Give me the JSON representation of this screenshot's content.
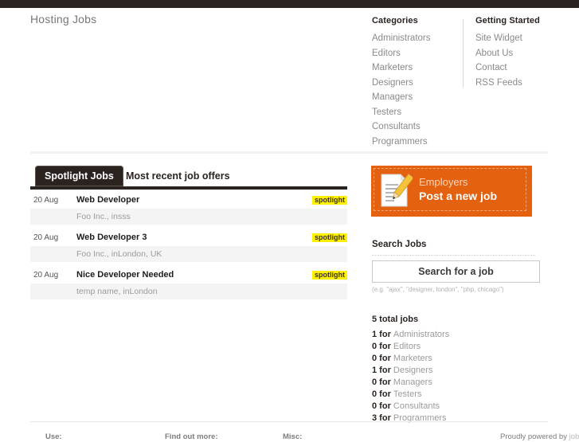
{
  "site": {
    "title": "Hosting Jobs"
  },
  "nav": {
    "categories": {
      "heading": "Categories",
      "items": [
        {
          "label": "Administrators"
        },
        {
          "label": "Editors"
        },
        {
          "label": "Marketers"
        },
        {
          "label": "Designers"
        },
        {
          "label": "Managers"
        },
        {
          "label": "Testers"
        },
        {
          "label": "Consultants"
        },
        {
          "label": "Programmers"
        }
      ]
    },
    "getting_started": {
      "heading": "Getting Started",
      "items": [
        {
          "label": "Site Widget"
        },
        {
          "label": "About Us"
        },
        {
          "label": "Contact"
        },
        {
          "label": "RSS Feeds"
        }
      ]
    }
  },
  "jobs_panel": {
    "tabs": [
      {
        "label": "Spotlight Jobs",
        "active": true
      },
      {
        "label": "Most recent job offers",
        "active": false
      }
    ],
    "listings": [
      {
        "date": "20 Aug",
        "title": "Web Developer",
        "company": "Foo Inc., insss",
        "badge": "spotlight"
      },
      {
        "date": "20 Aug",
        "title": "Web Developer 3",
        "company": "Foo Inc., inLondon, UK",
        "badge": "spotlight"
      },
      {
        "date": "20 Aug",
        "title": "Nice Developer Needed",
        "company": "temp name, inLondon",
        "badge": "spotlight"
      }
    ]
  },
  "sidebar": {
    "employers_banner": {
      "label": "Employers",
      "action": "Post a new job",
      "icon": "document-pencil-icon",
      "background_color": "#e4610f"
    },
    "search": {
      "heading": "Search Jobs",
      "value": "Search for a job",
      "placeholder": "Search for a job",
      "hint": "(e.g. \"ajax\", \"designer, london\", \"php, chicago\")"
    },
    "stats": {
      "total": "5 total jobs",
      "rows": [
        {
          "count": "1",
          "for": " for ",
          "category": "Administrators"
        },
        {
          "count": "0",
          "for": " for ",
          "category": "Editors"
        },
        {
          "count": "0",
          "for": " for ",
          "category": "Marketers"
        },
        {
          "count": "1",
          "for": " for ",
          "category": "Designers"
        },
        {
          "count": "0",
          "for": " for ",
          "category": "Managers"
        },
        {
          "count": "0",
          "for": " for ",
          "category": "Testers"
        },
        {
          "count": "0",
          "for": " for ",
          "category": "Consultants"
        },
        {
          "count": "3",
          "for": " for ",
          "category": "Programmers"
        }
      ]
    }
  },
  "footer": {
    "columns": [
      {
        "label": "Use:"
      },
      {
        "label": "Find out more:"
      },
      {
        "label": "Misc:"
      }
    ],
    "credit_prefix": "Proudly powered by ",
    "credit_brand": "jobber"
  },
  "colors": {
    "topbar": "#2b2320",
    "accent_orange": "#e4610f",
    "badge_yellow": "#fff000"
  }
}
